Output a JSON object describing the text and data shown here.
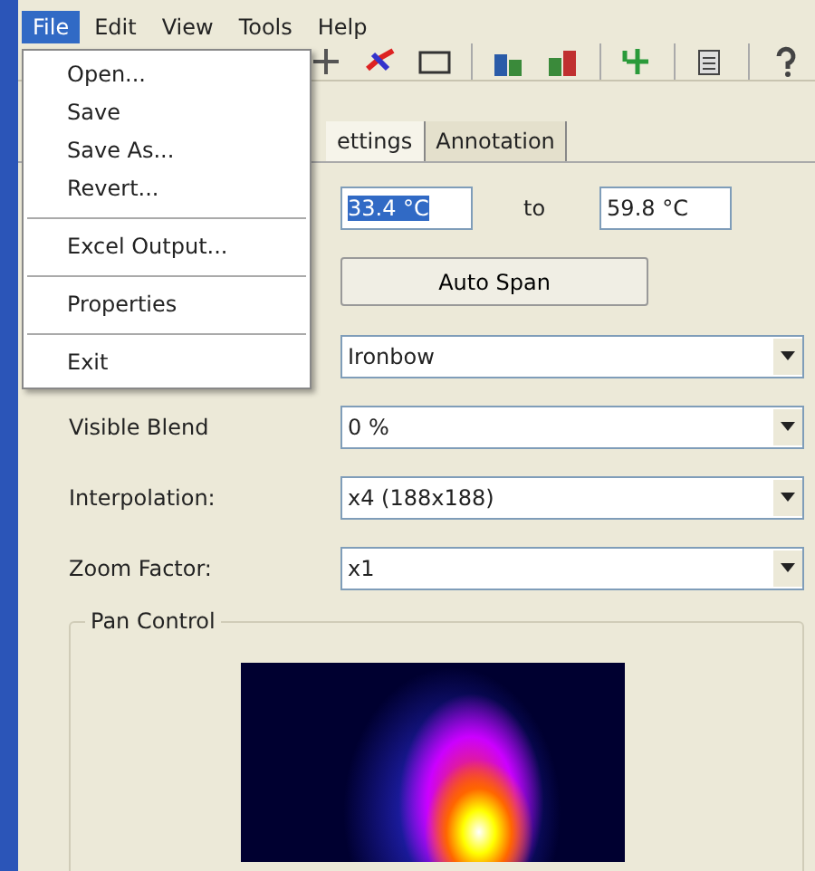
{
  "menu_bar": [
    {
      "label": "File",
      "selected": true
    },
    {
      "label": "Edit",
      "selected": false
    },
    {
      "label": "View",
      "selected": false
    },
    {
      "label": "Tools",
      "selected": false
    },
    {
      "label": "Help",
      "selected": false
    }
  ],
  "file_menu": [
    {
      "kind": "item",
      "label": "Open..."
    },
    {
      "kind": "item",
      "label": "Save"
    },
    {
      "kind": "item",
      "label": "Save As..."
    },
    {
      "kind": "item",
      "label": "Revert..."
    },
    {
      "kind": "separator"
    },
    {
      "kind": "item",
      "label": "Excel Output..."
    },
    {
      "kind": "separator"
    },
    {
      "kind": "item",
      "label": "Properties"
    },
    {
      "kind": "separator"
    },
    {
      "kind": "item",
      "label": "Exit"
    }
  ],
  "tabs": [
    {
      "label": "ettings",
      "selected": true
    },
    {
      "label": "Annotation",
      "selected": false
    }
  ],
  "range": {
    "from": "33.4 °C",
    "separator": "to",
    "to": "59.8 °C"
  },
  "auto_span_button": "Auto Span",
  "rows": [
    {
      "value": "Ironbow"
    },
    {
      "label": "Visible Blend",
      "value": "0 %"
    },
    {
      "label": "Interpolation:",
      "value": "x4 (188x188)"
    },
    {
      "label": "Zoom Factor:",
      "value": "x1"
    }
  ],
  "pan_control": {
    "title": "Pan Control"
  }
}
